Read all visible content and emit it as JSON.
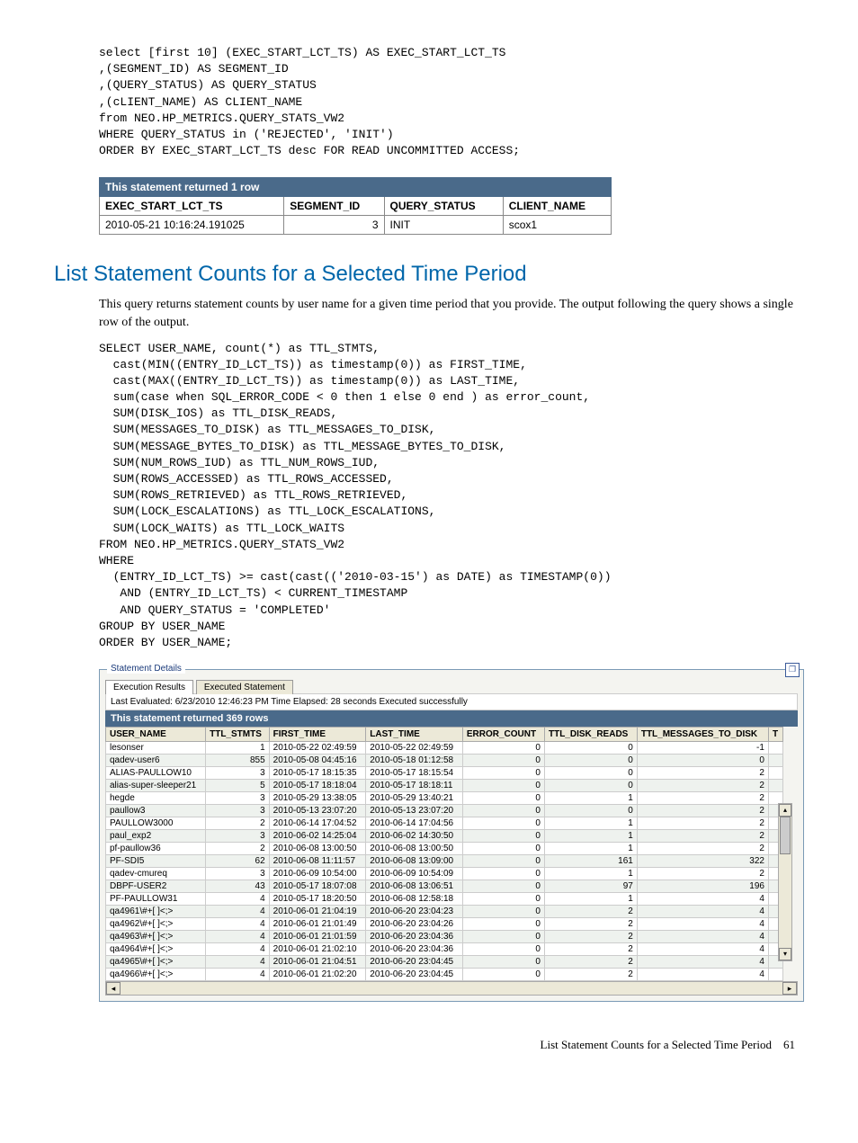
{
  "code1": "select [first 10] (EXEC_START_LCT_TS) AS EXEC_START_LCT_TS\n,(SEGMENT_ID) AS SEGMENT_ID\n,(QUERY_STATUS) AS QUERY_STATUS\n,(cLIENT_NAME) AS CLIENT_NAME\nfrom NEO.HP_METRICS.QUERY_STATS_VW2\nWHERE QUERY_STATUS in ('REJECTED', 'INIT')\nORDER BY EXEC_START_LCT_TS desc FOR READ UNCOMMITTED ACCESS;",
  "table1": {
    "banner": "This statement returned 1 row",
    "cols": [
      "EXEC_START_LCT_TS",
      "SEGMENT_ID",
      "QUERY_STATUS",
      "CLIENT_NAME"
    ],
    "row": [
      "2010-05-21 10:16:24.191025",
      "3",
      "INIT",
      "scox1"
    ]
  },
  "section_title": "List Statement Counts for a Selected Time Period",
  "body1": "This query returns statement counts by user name for a given time period that you provide. The output following the query shows a single row of the output.",
  "code2": "SELECT USER_NAME, count(*) as TTL_STMTS,\n  cast(MIN((ENTRY_ID_LCT_TS)) as timestamp(0)) as FIRST_TIME,\n  cast(MAX((ENTRY_ID_LCT_TS)) as timestamp(0)) as LAST_TIME,\n  sum(case when SQL_ERROR_CODE < 0 then 1 else 0 end ) as error_count,\n  SUM(DISK_IOS) as TTL_DISK_READS,\n  SUM(MESSAGES_TO_DISK) as TTL_MESSAGES_TO_DISK,\n  SUM(MESSAGE_BYTES_TO_DISK) as TTL_MESSAGE_BYTES_TO_DISK,\n  SUM(NUM_ROWS_IUD) as TTL_NUM_ROWS_IUD,\n  SUM(ROWS_ACCESSED) as TTL_ROWS_ACCESSED,\n  SUM(ROWS_RETRIEVED) as TTL_ROWS_RETRIEVED,\n  SUM(LOCK_ESCALATIONS) as TTL_LOCK_ESCALATIONS,\n  SUM(LOCK_WAITS) as TTL_LOCK_WAITS\nFROM NEO.HP_METRICS.QUERY_STATS_VW2\nWHERE\n  (ENTRY_ID_LCT_TS) >= cast(cast(('2010-03-15') as DATE) as TIMESTAMP(0))\n   AND (ENTRY_ID_LCT_TS) < CURRENT_TIMESTAMP\n   AND QUERY_STATUS = 'COMPLETED'\nGROUP BY USER_NAME\nORDER BY USER_NAME;",
  "details": {
    "legend": "Statement Details",
    "tab1": "Execution Results",
    "tab2": "Executed Statement",
    "status": "Last Evaluated: 6/23/2010 12:46:23 PM   Time Elapsed: 28 seconds    Executed successfully",
    "banner": "This statement returned 369 rows",
    "cols": [
      "USER_NAME",
      "TTL_STMTS",
      "FIRST_TIME",
      "LAST_TIME",
      "ERROR_COUNT",
      "TTL_DISK_READS",
      "TTL_MESSAGES_TO_DISK",
      "T"
    ],
    "rows": [
      [
        "lesonser",
        "1",
        "2010-05-22 02:49:59",
        "2010-05-22 02:49:59",
        "0",
        "0",
        "-1"
      ],
      [
        "qadev-user6",
        "855",
        "2010-05-08 04:45:16",
        "2010-05-18 01:12:58",
        "0",
        "0",
        "0"
      ],
      [
        "ALIAS-PAULLOW10",
        "3",
        "2010-05-17 18:15:35",
        "2010-05-17 18:15:54",
        "0",
        "0",
        "2"
      ],
      [
        "alias-super-sleeper21",
        "5",
        "2010-05-17 18:18:04",
        "2010-05-17 18:18:11",
        "0",
        "0",
        "2"
      ],
      [
        "hegde",
        "3",
        "2010-05-29 13:38:05",
        "2010-05-29 13:40:21",
        "0",
        "1",
        "2"
      ],
      [
        "paullow3",
        "3",
        "2010-05-13 23:07:20",
        "2010-05-13 23:07:20",
        "0",
        "0",
        "2"
      ],
      [
        "PAULLOW3000",
        "2",
        "2010-06-14 17:04:52",
        "2010-06-14 17:04:56",
        "0",
        "1",
        "2"
      ],
      [
        "paul_exp2",
        "3",
        "2010-06-02 14:25:04",
        "2010-06-02 14:30:50",
        "0",
        "1",
        "2"
      ],
      [
        "pf-paullow36",
        "2",
        "2010-06-08 13:00:50",
        "2010-06-08 13:00:50",
        "0",
        "1",
        "2"
      ],
      [
        "PF-SDI5",
        "62",
        "2010-06-08 11:11:57",
        "2010-06-08 13:09:00",
        "0",
        "161",
        "322"
      ],
      [
        "qadev-cmureq",
        "3",
        "2010-06-09 10:54:00",
        "2010-06-09 10:54:09",
        "0",
        "1",
        "2"
      ],
      [
        "DBPF-USER2",
        "43",
        "2010-05-17 18:07:08",
        "2010-06-08 13:06:51",
        "0",
        "97",
        "196"
      ],
      [
        "PF-PAULLOW31",
        "4",
        "2010-05-17 18:20:50",
        "2010-06-08 12:58:18",
        "0",
        "1",
        "4"
      ],
      [
        "qa4961\\#+[ ]<;>",
        "4",
        "2010-06-01 21:04:19",
        "2010-06-20 23:04:23",
        "0",
        "2",
        "4"
      ],
      [
        "qa4962\\#+[ ]<;>",
        "4",
        "2010-06-01 21:01:49",
        "2010-06-20 23:04:26",
        "0",
        "2",
        "4"
      ],
      [
        "qa4963\\#+[ ]<;>",
        "4",
        "2010-06-01 21:01:59",
        "2010-06-20 23:04:36",
        "0",
        "2",
        "4"
      ],
      [
        "qa4964\\#+[ ]<;>",
        "4",
        "2010-06-01 21:02:10",
        "2010-06-20 23:04:36",
        "0",
        "2",
        "4"
      ],
      [
        "qa4965\\#+[ ]<;>",
        "4",
        "2010-06-01 21:04:51",
        "2010-06-20 23:04:45",
        "0",
        "2",
        "4"
      ],
      [
        "qa4966\\#+[ ]<;>",
        "4",
        "2010-06-01 21:02:20",
        "2010-06-20 23:04:45",
        "0",
        "2",
        "4"
      ]
    ]
  },
  "footer": {
    "text": "List Statement Counts for a Selected Time Period",
    "page": "61"
  }
}
